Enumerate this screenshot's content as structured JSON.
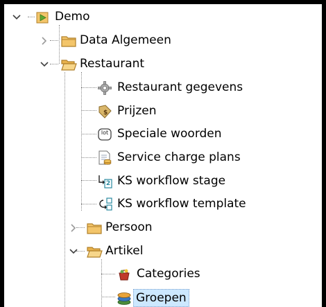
{
  "tree": {
    "root": {
      "label": "Demo",
      "icon": "project-icon",
      "expanded": true
    },
    "data_algemeen": {
      "label": "Data Algemeen",
      "icon": "folder-icon",
      "expanded": false
    },
    "restaurant": {
      "label": "Restaurant",
      "icon": "folder-icon",
      "expanded": true
    },
    "restaurant_gegevens": {
      "label": "Restaurant gegevens",
      "icon": "gear-icon"
    },
    "prijzen": {
      "label": "Prijzen",
      "icon": "price-tag-icon"
    },
    "speciale_woorden": {
      "label": "Speciale woorden",
      "icon": "text-badge-icon",
      "badge": "lot"
    },
    "service_charge_plans": {
      "label": "Service charge plans",
      "icon": "document-coins-icon"
    },
    "ks_workflow_stage": {
      "label": "KS workflow stage",
      "icon": "workflow-stage-icon",
      "badge": "2"
    },
    "ks_workflow_template": {
      "label": "KS workflow template",
      "icon": "workflow-template-icon"
    },
    "persoon": {
      "label": "Persoon",
      "icon": "folder-icon",
      "expanded": false
    },
    "artikel": {
      "label": "Artikel",
      "icon": "folder-icon",
      "expanded": true
    },
    "categories": {
      "label": "Categories",
      "icon": "basket-icon"
    },
    "groepen": {
      "label": "Groepen",
      "icon": "group-stack-icon",
      "selected": true
    }
  },
  "colors": {
    "folder": "#f3c56a",
    "folder_edge": "#b0802a",
    "selection": "#cce8ff",
    "tree_lines": "#8a8a8a",
    "chevron": "#404040"
  }
}
